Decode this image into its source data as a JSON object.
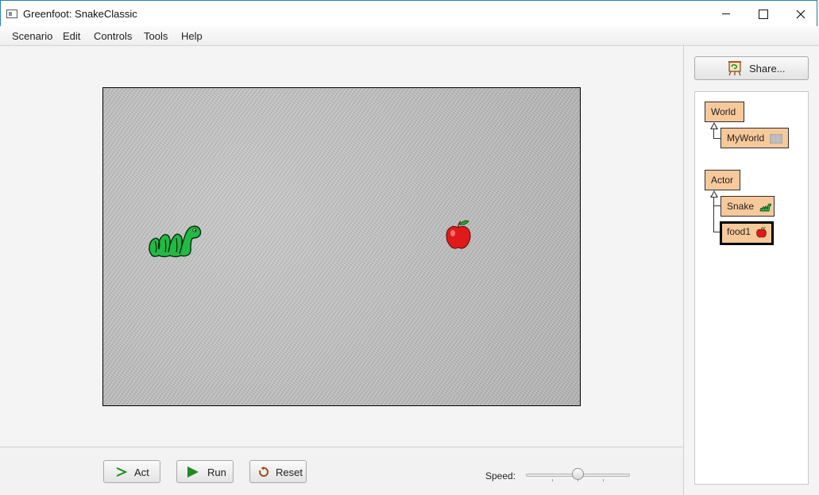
{
  "window": {
    "title": "Greenfoot: SnakeClassic"
  },
  "menu": {
    "items": [
      "Scenario",
      "Edit",
      "Controls",
      "Tools",
      "Help"
    ]
  },
  "controls": {
    "act_label": "Act",
    "run_label": "Run",
    "reset_label": "Reset",
    "speed_label": "Speed:",
    "speed_value": 0.5
  },
  "share": {
    "label": "Share..."
  },
  "classes": {
    "world": "World",
    "myworld": "MyWorld",
    "actor": "Actor",
    "snake": "Snake",
    "food1": "food1"
  },
  "colors": {
    "class_box": "#f7c99a",
    "snake_green": "#1fb541",
    "apple_red": "#e01a1a",
    "play_green": "#1f8a1f",
    "reset_brown": "#a44a1c"
  }
}
